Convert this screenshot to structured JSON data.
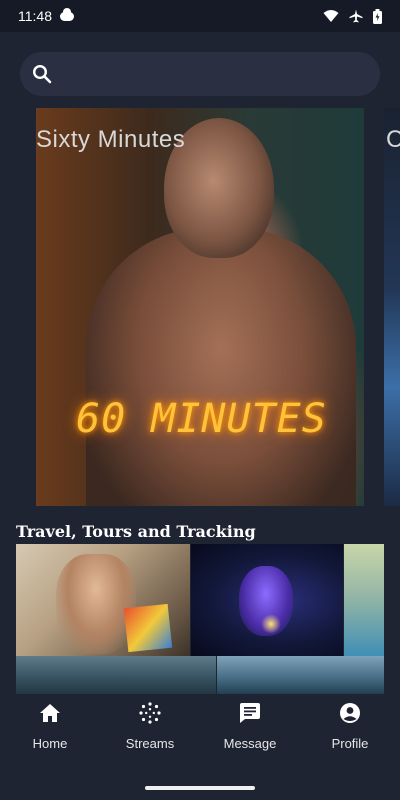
{
  "status_bar": {
    "time": "11:48"
  },
  "search": {
    "placeholder": ""
  },
  "hero": {
    "title": "Sixty Minutes",
    "poster_text": "60 MINUTES",
    "next_title_peek": "C"
  },
  "section": {
    "title": "Travel, Tours and Tracking"
  },
  "bottom_nav": {
    "items": [
      {
        "label": "Home",
        "icon": "home-icon"
      },
      {
        "label": "Streams",
        "icon": "streams-icon"
      },
      {
        "label": "Message",
        "icon": "message-icon"
      },
      {
        "label": "Profile",
        "icon": "profile-icon"
      }
    ]
  },
  "colors": {
    "background": "#1f2433",
    "search_bg": "#2a3042",
    "neon": "#ffc23a"
  }
}
